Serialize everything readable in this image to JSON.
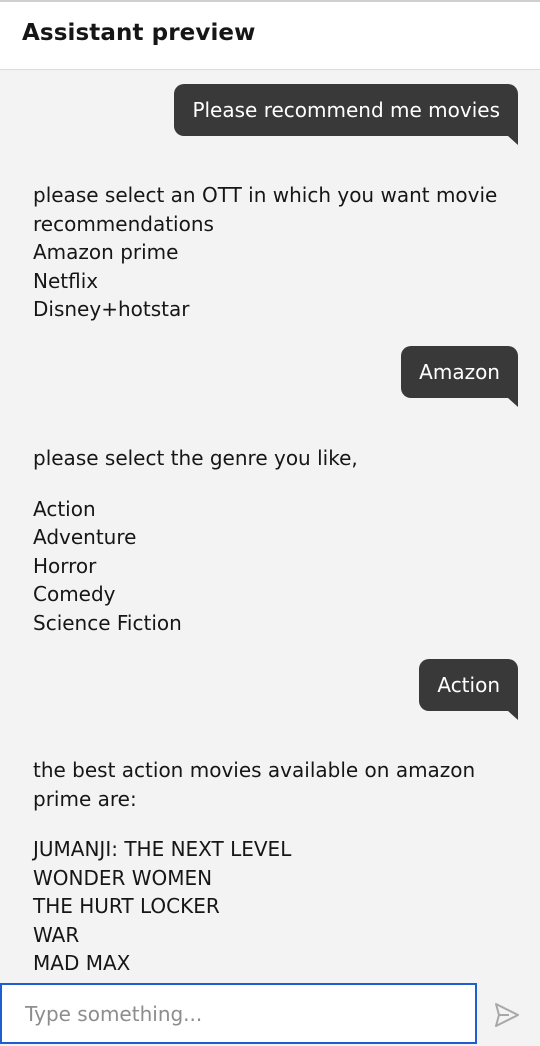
{
  "header": {
    "title": "Assistant preview"
  },
  "conversation": {
    "user_1": "Please recommend me movies",
    "bot_1": {
      "lines": [
        "please select an OTT in which you want movie",
        "recommendations",
        "Amazon prime",
        "Netflix",
        "Disney+hotstar"
      ]
    },
    "user_2": "Amazon",
    "bot_2": {
      "intro": "please select the genre you like,",
      "options": [
        "Action",
        "Adventure",
        "Horror",
        "Comedy",
        "Science Fiction"
      ]
    },
    "user_3": "Action",
    "bot_3": {
      "intro_lines": [
        "the best action movies available on amazon",
        "prime are:"
      ],
      "movies": [
        "JUMANJI: THE NEXT LEVEL",
        "WONDER WOMEN",
        "THE HURT LOCKER",
        "WAR",
        "MAD MAX"
      ]
    }
  },
  "composer": {
    "placeholder": "Type something...",
    "value": "",
    "send_icon": "send-icon"
  },
  "colors": {
    "user_bubble": "#393939",
    "background": "#f3f3f3",
    "input_focus": "#1d5fd1"
  }
}
